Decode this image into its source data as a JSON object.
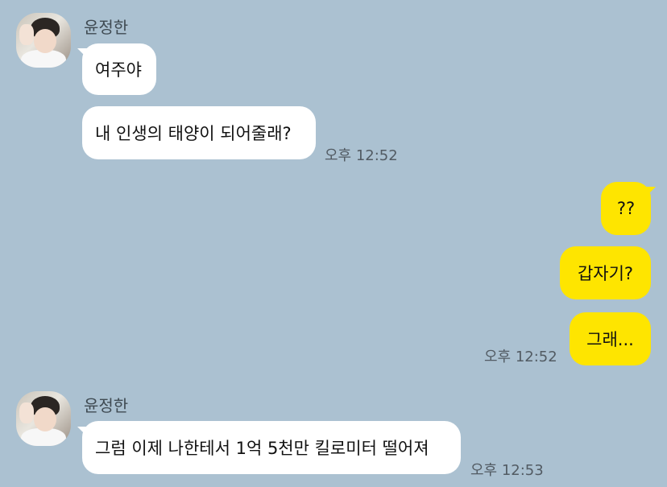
{
  "colors": {
    "background": "#abc1d1",
    "incoming_bubble": "#ffffff",
    "outgoing_bubble": "#fee500",
    "timestamp": "#525b63"
  },
  "groups": [
    {
      "sender": "윤정한",
      "messages": [
        "여주야",
        "내 인생의 태양이 되어줄래?"
      ],
      "time": "오후 12:52"
    },
    {
      "messages": [
        "??",
        "갑자기?",
        "그래..."
      ],
      "time": "오후 12:52"
    },
    {
      "sender": "윤정한",
      "messages": [
        "그럼 이제 나한테서 1억 5천만 킬로미터 떨어져"
      ],
      "time": "오후 12:53"
    }
  ]
}
